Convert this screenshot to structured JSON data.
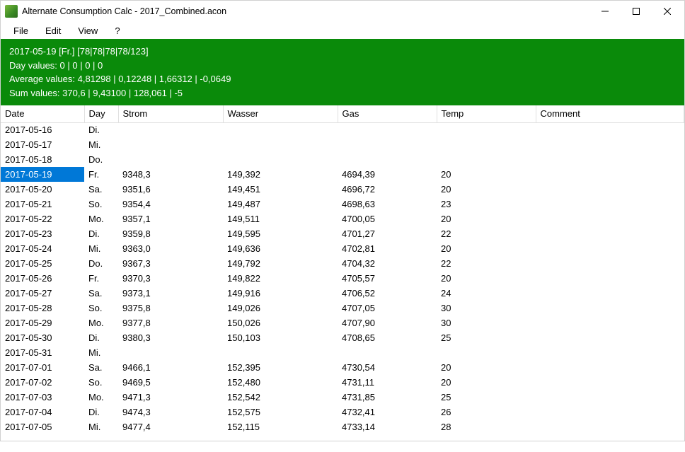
{
  "window": {
    "title": "Alternate Consumption Calc - 2017_Combined.acon"
  },
  "menu": {
    "file": "File",
    "edit": "Edit",
    "view": "View",
    "help": "?"
  },
  "info": {
    "line1": "2017-05-19 [Fr.] [78|78|78|78/123]",
    "line2": "Day values: 0 | 0 | 0 | 0",
    "line3": "Average values: 4,81298 | 0,12248 | 1,66312 | -0,0649",
    "line4": "Sum values: 370,6 | 9,43100 | 128,061 | -5"
  },
  "columns": {
    "date": "Date",
    "day": "Day",
    "strom": "Strom",
    "wasser": "Wasser",
    "gas": "Gas",
    "temp": "Temp",
    "comment": "Comment"
  },
  "rows": [
    {
      "date": "2017-05-16",
      "day": "Di.",
      "strom": "",
      "wasser": "",
      "gas": "",
      "temp": "",
      "comment": ""
    },
    {
      "date": "2017-05-17",
      "day": "Mi.",
      "strom": "",
      "wasser": "",
      "gas": "",
      "temp": "",
      "comment": ""
    },
    {
      "date": "2017-05-18",
      "day": "Do.",
      "strom": "",
      "wasser": "",
      "gas": "",
      "temp": "",
      "comment": ""
    },
    {
      "date": "2017-05-19",
      "day": "Fr.",
      "strom": "9348,3",
      "wasser": "149,392",
      "gas": "4694,39",
      "temp": "20",
      "comment": "",
      "selected": true
    },
    {
      "date": "2017-05-20",
      "day": "Sa.",
      "strom": "9351,6",
      "wasser": "149,451",
      "gas": "4696,72",
      "temp": "20",
      "comment": ""
    },
    {
      "date": "2017-05-21",
      "day": "So.",
      "strom": "9354,4",
      "wasser": "149,487",
      "gas": "4698,63",
      "temp": "23",
      "comment": ""
    },
    {
      "date": "2017-05-22",
      "day": "Mo.",
      "strom": "9357,1",
      "wasser": "149,511",
      "gas": "4700,05",
      "temp": "20",
      "comment": ""
    },
    {
      "date": "2017-05-23",
      "day": "Di.",
      "strom": "9359,8",
      "wasser": "149,595",
      "gas": "4701,27",
      "temp": "22",
      "comment": ""
    },
    {
      "date": "2017-05-24",
      "day": "Mi.",
      "strom": "9363,0",
      "wasser": "149,636",
      "gas": "4702,81",
      "temp": "20",
      "comment": ""
    },
    {
      "date": "2017-05-25",
      "day": "Do.",
      "strom": "9367,3",
      "wasser": "149,792",
      "gas": "4704,32",
      "temp": "22",
      "comment": ""
    },
    {
      "date": "2017-05-26",
      "day": "Fr.",
      "strom": "9370,3",
      "wasser": "149,822",
      "gas": "4705,57",
      "temp": "20",
      "comment": ""
    },
    {
      "date": "2017-05-27",
      "day": "Sa.",
      "strom": "9373,1",
      "wasser": "149,916",
      "gas": "4706,52",
      "temp": "24",
      "comment": ""
    },
    {
      "date": "2017-05-28",
      "day": "So.",
      "strom": "9375,8",
      "wasser": "149,026",
      "gas": "4707,05",
      "temp": "30",
      "comment": ""
    },
    {
      "date": "2017-05-29",
      "day": "Mo.",
      "strom": "9377,8",
      "wasser": "150,026",
      "gas": "4707,90",
      "temp": "30",
      "comment": ""
    },
    {
      "date": "2017-05-30",
      "day": "Di.",
      "strom": "9380,3",
      "wasser": "150,103",
      "gas": "4708,65",
      "temp": "25",
      "comment": ""
    },
    {
      "date": "2017-05-31",
      "day": "Mi.",
      "strom": "",
      "wasser": "",
      "gas": "",
      "temp": "",
      "comment": ""
    },
    {
      "date": "2017-07-01",
      "day": "Sa.",
      "strom": "9466,1",
      "wasser": "152,395",
      "gas": "4730,54",
      "temp": "20",
      "comment": ""
    },
    {
      "date": "2017-07-02",
      "day": "So.",
      "strom": "9469,5",
      "wasser": "152,480",
      "gas": "4731,11",
      "temp": "20",
      "comment": ""
    },
    {
      "date": "2017-07-03",
      "day": "Mo.",
      "strom": "9471,3",
      "wasser": "152,542",
      "gas": "4731,85",
      "temp": "25",
      "comment": ""
    },
    {
      "date": "2017-07-04",
      "day": "Di.",
      "strom": "9474,3",
      "wasser": "152,575",
      "gas": "4732,41",
      "temp": "26",
      "comment": ""
    },
    {
      "date": "2017-07-05",
      "day": "Mi.",
      "strom": "9477,4",
      "wasser": "152,115",
      "gas": "4733,14",
      "temp": "28",
      "comment": ""
    }
  ]
}
